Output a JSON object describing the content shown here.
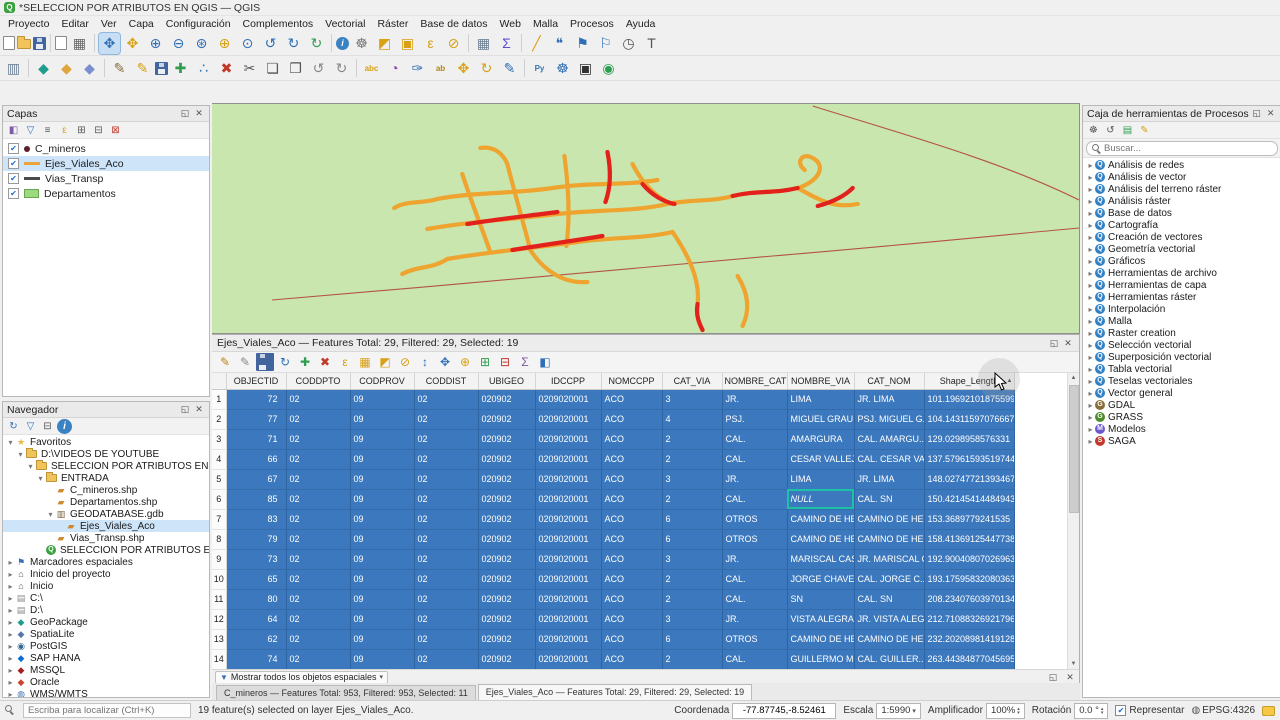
{
  "window": {
    "title": "*SELECCION POR ATRIBUTOS EN QGIS — QGIS"
  },
  "menubar": {
    "items": [
      "Proyecto",
      "Editar",
      "Ver",
      "Capa",
      "Configuración",
      "Complementos",
      "Vectorial",
      "Ráster",
      "Base de datos",
      "Web",
      "Malla",
      "Procesos",
      "Ayuda"
    ]
  },
  "toolbars": {
    "main": [
      {
        "n": "new-project",
        "t": "page"
      },
      {
        "n": "open-project",
        "t": "folder"
      },
      {
        "n": "save-project",
        "t": "disk"
      },
      {
        "sep": true
      },
      {
        "n": "new-print-layout",
        "t": "page"
      },
      {
        "n": "layout-manager",
        "g": "▦",
        "c": "#666666"
      },
      {
        "sep": true
      },
      {
        "n": "pan-map",
        "g": "✥",
        "c": "#2f6fb5",
        "active": true
      },
      {
        "n": "pan-to-selection",
        "g": "✥",
        "c": "#d8a013"
      },
      {
        "n": "zoom-in",
        "g": "⊕",
        "c": "#2f6fb5"
      },
      {
        "n": "zoom-out",
        "g": "⊖",
        "c": "#2f6fb5"
      },
      {
        "n": "zoom-full",
        "g": "⊛",
        "c": "#2f6fb5"
      },
      {
        "n": "zoom-to-selection",
        "g": "⊕",
        "c": "#d8a013"
      },
      {
        "n": "zoom-to-layer",
        "g": "⊙",
        "c": "#2f6fb5"
      },
      {
        "n": "zoom-last",
        "g": "↺",
        "c": "#2f6fb5"
      },
      {
        "n": "zoom-next",
        "g": "↻",
        "c": "#2f6fb5"
      },
      {
        "n": "refresh-map",
        "g": "↻",
        "c": "#2e9e4f"
      },
      {
        "sep": true
      },
      {
        "n": "identify-features",
        "t": "ci"
      },
      {
        "n": "run-feature-action",
        "g": "☸",
        "c": "#777777"
      },
      {
        "n": "select-features",
        "g": "◩",
        "c": "#d8a013"
      },
      {
        "n": "select-by-value",
        "g": "▣",
        "c": "#d8a013"
      },
      {
        "n": "select-by-expression",
        "g": "ε",
        "c": "#d8a013"
      },
      {
        "n": "deselect-all",
        "g": "⊘",
        "c": "#d8a013"
      },
      {
        "sep": true
      },
      {
        "n": "open-attribute-table",
        "g": "▦",
        "c": "#6b7f94"
      },
      {
        "n": "statistical-summary",
        "g": "Σ",
        "c": "#5a4fcf"
      },
      {
        "sep": true
      },
      {
        "n": "measure-line",
        "g": "╱",
        "c": "#d8a013"
      },
      {
        "n": "map-tips",
        "g": "❝",
        "c": "#2f6fb5"
      },
      {
        "n": "new-bookmark",
        "g": "⚑",
        "c": "#2f6fb5"
      },
      {
        "n": "show-bookmarks",
        "g": "⚐",
        "c": "#2f6fb5"
      },
      {
        "n": "temporal-controller",
        "g": "◷",
        "c": "#555555"
      },
      {
        "n": "text-annotation",
        "g": "T",
        "c": "#555555"
      }
    ],
    "digitizing": [
      {
        "n": "open-data-source-manager",
        "g": "▥",
        "c": "#6b7f94"
      },
      {
        "sep": true
      },
      {
        "n": "new-geopackage-layer",
        "g": "◆",
        "c": "#1f9d8b"
      },
      {
        "n": "new-shapefile-layer",
        "g": "◆",
        "c": "#e0a53c"
      },
      {
        "n": "new-virtual-layer",
        "g": "◆",
        "c": "#7b8fd0"
      },
      {
        "sep": true
      },
      {
        "n": "current-edits",
        "g": "✎",
        "c": "#8a6d3b"
      },
      {
        "n": "toggle-editing",
        "g": "✎",
        "c": "#d8a013"
      },
      {
        "n": "save-layer-edits",
        "t": "disk"
      },
      {
        "n": "add-line-feature",
        "g": "✚",
        "c": "#2e9e4f"
      },
      {
        "n": "vertex-tool",
        "g": "∴",
        "c": "#2f6fb5"
      },
      {
        "n": "delete-selected",
        "g": "✖",
        "c": "#c0392b"
      },
      {
        "n": "cut-features",
        "g": "✂",
        "c": "#555555"
      },
      {
        "n": "copy-features",
        "g": "❏",
        "c": "#555555"
      },
      {
        "n": "paste-features",
        "g": "❐",
        "c": "#555555"
      },
      {
        "n": "undo",
        "g": "↺",
        "c": "#888888"
      },
      {
        "n": "redo",
        "g": "↻",
        "c": "#888888"
      },
      {
        "sep": true
      },
      {
        "n": "layer-labeling",
        "g": "abc",
        "c": "#d8a013"
      },
      {
        "n": "layer-diagram",
        "g": "◔",
        "c": "#8e44ad"
      },
      {
        "n": "pin-labels",
        "g": "✑",
        "c": "#2f6fb5"
      },
      {
        "n": "highlight-labels",
        "g": "ab",
        "c": "#b8860b"
      },
      {
        "n": "move-label",
        "g": "✥",
        "c": "#d8a013"
      },
      {
        "n": "rotate-label",
        "g": "↻",
        "c": "#d8a013"
      },
      {
        "n": "change-label",
        "g": "✎",
        "c": "#2f6fb5"
      },
      {
        "sep": true
      },
      {
        "n": "python-console",
        "g": "Py",
        "c": "#3776ab"
      },
      {
        "n": "processing-toolbox",
        "g": "☸",
        "c": "#2f6fb5"
      },
      {
        "n": "vehicle-routing",
        "g": "▣",
        "c": "#333333"
      },
      {
        "n": "quickmap-services",
        "g": "◉",
        "c": "#2e9e4f"
      }
    ]
  },
  "layers_panel": {
    "title": "Capas",
    "toolbar": [
      {
        "n": "open-layer-styling",
        "g": "◧",
        "c": "#7d5ba6"
      },
      {
        "n": "filter-legend",
        "g": "▽",
        "c": "#2f6fb5"
      },
      {
        "n": "manage-map-themes",
        "g": "≡",
        "c": "#555555"
      },
      {
        "n": "filter-legend-expression",
        "g": "ε",
        "c": "#d8a013"
      },
      {
        "n": "expand-all",
        "g": "⊞",
        "c": "#555555"
      },
      {
        "n": "collapse-all",
        "g": "⊟",
        "c": "#555555"
      },
      {
        "n": "remove-layer",
        "g": "⊠",
        "c": "#c0392b"
      }
    ],
    "layers": [
      {
        "name": "C_mineros",
        "type": "point",
        "checked": true,
        "selected": false
      },
      {
        "name": "Ejes_Viales_Aco",
        "type": "line-orange",
        "checked": true,
        "selected": true
      },
      {
        "name": "Vias_Transp",
        "type": "line-dark",
        "checked": true,
        "selected": false
      },
      {
        "name": "Departamentos",
        "type": "polygon",
        "checked": true,
        "selected": false
      }
    ]
  },
  "browser_panel": {
    "title": "Navegador",
    "toolbar": [
      {
        "n": "refresh-browser",
        "g": "↻",
        "c": "#2f6fb5"
      },
      {
        "n": "filter-browser",
        "g": "▽",
        "c": "#2f6fb5"
      },
      {
        "n": "collapse-browser",
        "g": "⊟",
        "c": "#555555"
      },
      {
        "n": "browser-properties",
        "t": "ci"
      }
    ],
    "items": [
      {
        "label": "Favoritos",
        "depth": 0,
        "icon": "star",
        "expand": "v"
      },
      {
        "label": "D:\\VIDEOS DE YOUTUBE",
        "depth": 1,
        "icon": "folder",
        "expand": "v"
      },
      {
        "label": "SELECCION POR ATRIBUTOS EN QGIS",
        "depth": 2,
        "icon": "folder",
        "expand": "v"
      },
      {
        "label": "ENTRADA",
        "depth": 3,
        "icon": "folder",
        "expand": "v"
      },
      {
        "label": "C_mineros.shp",
        "depth": 4,
        "icon": "vector"
      },
      {
        "label": "Departamentos.shp",
        "depth": 4,
        "icon": "vector"
      },
      {
        "label": "GEODATABASE.gdb",
        "depth": 4,
        "icon": "database",
        "expand": "v"
      },
      {
        "label": "Ejes_Viales_Aco",
        "depth": 5,
        "icon": "vector",
        "selected": true
      },
      {
        "label": "Vias_Transp.shp",
        "depth": 4,
        "icon": "vector"
      },
      {
        "label": "SELECCION POR ATRIBUTOS EN QGIS",
        "depth": 3,
        "icon": "project"
      },
      {
        "label": "Marcadores espaciales",
        "depth": 0,
        "icon": "bookmark",
        "expand": ">"
      },
      {
        "label": "Inicio del proyecto",
        "depth": 0,
        "icon": "home",
        "expand": ">"
      },
      {
        "label": "Inicio",
        "depth": 0,
        "icon": "home",
        "expand": ">"
      },
      {
        "label": "C:\\",
        "depth": 0,
        "icon": "drive",
        "expand": ">"
      },
      {
        "label": "D:\\",
        "depth": 0,
        "icon": "drive",
        "expand": ">"
      },
      {
        "label": "GeoPackage",
        "depth": 0,
        "icon": "gpkg",
        "expand": ">"
      },
      {
        "label": "SpatiaLite",
        "depth": 0,
        "icon": "sqlite",
        "expand": ">"
      },
      {
        "label": "PostGIS",
        "depth": 0,
        "icon": "postgis",
        "expand": ">"
      },
      {
        "label": "SAP HANA",
        "depth": 0,
        "icon": "hana",
        "expand": ">"
      },
      {
        "label": "MSSQL",
        "depth": 0,
        "icon": "mssql",
        "expand": ">"
      },
      {
        "label": "Oracle",
        "depth": 0,
        "icon": "oracle",
        "expand": ">"
      },
      {
        "label": "WMS/WMTS",
        "depth": 0,
        "icon": "wms",
        "expand": ">"
      }
    ]
  },
  "browser_icon_glyphs": {
    "star": {
      "g": "★",
      "c": "#e8b93c"
    },
    "vector": {
      "g": "▰",
      "c": "#cd8a2e"
    },
    "database": {
      "g": "▥",
      "c": "#7a5c3a"
    },
    "bookmark": {
      "g": "⚑",
      "c": "#3b6fb5"
    },
    "home": {
      "g": "⌂",
      "c": "#555555"
    },
    "drive": {
      "g": "▤",
      "c": "#8a8a8a"
    },
    "gpkg": {
      "g": "◆",
      "c": "#1f9d8b"
    },
    "sqlite": {
      "g": "◆",
      "c": "#5577aa"
    },
    "postgis": {
      "g": "◉",
      "c": "#336791"
    },
    "hana": {
      "g": "◆",
      "c": "#0a6ed1"
    },
    "mssql": {
      "g": "◆",
      "c": "#a91d22"
    },
    "oracle": {
      "g": "◆",
      "c": "#c74634"
    },
    "wms": {
      "g": "◍",
      "c": "#3b6fb5"
    }
  },
  "toolbox_panel": {
    "title": "Caja de herramientas de Procesos",
    "search_placeholder": "Buscar...",
    "toolbar": [
      {
        "n": "processing-options",
        "g": "☸",
        "c": "#555555"
      },
      {
        "n": "processing-history",
        "g": "↺",
        "c": "#555555"
      },
      {
        "n": "results-viewer",
        "g": "▤",
        "c": "#2e9e4f"
      },
      {
        "n": "edit-features-in-place",
        "g": "✎",
        "c": "#d8a013"
      }
    ],
    "badges": {
      "q": {
        "letter": "Q",
        "color": "#2f81c7"
      },
      "gdal": {
        "letter": "G",
        "color": "#8a6d3b"
      },
      "grass": {
        "letter": "G",
        "color": "#4c8c2b"
      },
      "model": {
        "letter": "M",
        "color": "#6a5acd"
      },
      "saga": {
        "letter": "S",
        "color": "#c0392b"
      }
    },
    "groups": [
      {
        "label": "Análisis de redes",
        "icon": "q"
      },
      {
        "label": "Análisis de vector",
        "icon": "q"
      },
      {
        "label": "Análisis del terreno ráster",
        "icon": "q"
      },
      {
        "label": "Análisis ráster",
        "icon": "q"
      },
      {
        "label": "Base de datos",
        "icon": "q"
      },
      {
        "label": "Cartografía",
        "icon": "q"
      },
      {
        "label": "Creación de vectores",
        "icon": "q"
      },
      {
        "label": "Geometría vectorial",
        "icon": "q"
      },
      {
        "label": "Gráficos",
        "icon": "q"
      },
      {
        "label": "Herramientas de archivo",
        "icon": "q"
      },
      {
        "label": "Herramientas de capa",
        "icon": "q"
      },
      {
        "label": "Herramientas ráster",
        "icon": "q"
      },
      {
        "label": "Interpolación",
        "icon": "q"
      },
      {
        "label": "Malla",
        "icon": "q"
      },
      {
        "label": "Raster creation",
        "icon": "q"
      },
      {
        "label": "Selección vectorial",
        "icon": "q"
      },
      {
        "label": "Superposición vectorial",
        "icon": "q"
      },
      {
        "label": "Tabla vectorial",
        "icon": "q"
      },
      {
        "label": "Teselas vectoriales",
        "icon": "q"
      },
      {
        "label": "Vector general",
        "icon": "q"
      },
      {
        "label": "GDAL",
        "icon": "gdal"
      },
      {
        "label": "GRASS",
        "icon": "grass"
      },
      {
        "label": "Modelos",
        "icon": "model"
      },
      {
        "label": "SAGA",
        "icon": "saga"
      }
    ]
  },
  "attribute_table": {
    "title": "Ejes_Viales_Aco — Features Total: 29, Filtered: 29, Selected: 19",
    "toolbar": [
      {
        "n": "table-toggle-editing",
        "g": "✎",
        "c": "#b8860b"
      },
      {
        "n": "table-multiedit",
        "g": "✎",
        "c": "#888888"
      },
      {
        "n": "table-save-edits",
        "t": "disk"
      },
      {
        "n": "table-reload",
        "g": "↻",
        "c": "#2f6fb5"
      },
      {
        "n": "table-add-feature",
        "g": "✚",
        "c": "#2e9e4f"
      },
      {
        "n": "table-delete-selected",
        "g": "✖",
        "c": "#c0392b"
      },
      {
        "n": "table-select-by-expression",
        "g": "ε",
        "c": "#d8a013"
      },
      {
        "n": "table-select-all",
        "g": "▦",
        "c": "#d8a013"
      },
      {
        "n": "table-invert-selection",
        "g": "◩",
        "c": "#d8a013"
      },
      {
        "n": "table-deselect-all",
        "g": "⊘",
        "c": "#d8a013"
      },
      {
        "n": "table-move-selection-top",
        "g": "↕",
        "c": "#2f6fb5"
      },
      {
        "n": "table-pan-to-selection",
        "g": "✥",
        "c": "#2f6fb5"
      },
      {
        "n": "table-zoom-to-selection",
        "g": "⊕",
        "c": "#d8a013"
      },
      {
        "n": "table-new-field",
        "g": "⊞",
        "c": "#2e9e4f"
      },
      {
        "n": "table-delete-field",
        "g": "⊟",
        "c": "#c0392b"
      },
      {
        "n": "table-field-calculator",
        "g": "Σ",
        "c": "#7a5c9e"
      },
      {
        "n": "table-conditional-formatting",
        "g": "◧",
        "c": "#2f6fb5"
      }
    ],
    "columns": [
      "OBJECTID",
      "CODDPTO",
      "CODPROV",
      "CODDIST",
      "UBIGEO",
      "IDCCPP",
      "NOMCCPP",
      "CAT_VIA",
      "NOMBRE_CAT",
      "NOMBRE_VIA",
      "CAT_NOM",
      "Shape_Length"
    ],
    "sorted_column": "Shape_Length",
    "sort_direction": "asc",
    "filter_button": "Mostrar todos los objetos espaciales",
    "null_cell": {
      "row": 5,
      "col": 9
    },
    "rows": [
      [
        "72",
        "02",
        "09",
        "02",
        "020902",
        "0209020001",
        "ACO",
        "3",
        "JR.",
        "LIMA",
        "JR. LIMA",
        "101.19692101875599"
      ],
      [
        "77",
        "02",
        "09",
        "02",
        "020902",
        "0209020001",
        "ACO",
        "4",
        "PSJ.",
        "MIGUEL GRAU",
        "PSJ. MIGUEL G...",
        "104.14311597076667"
      ],
      [
        "71",
        "02",
        "09",
        "02",
        "020902",
        "0209020001",
        "ACO",
        "2",
        "CAL.",
        "AMARGURA",
        "CAL. AMARGU...",
        "129.0298958576331"
      ],
      [
        "66",
        "02",
        "09",
        "02",
        "020902",
        "0209020001",
        "ACO",
        "2",
        "CAL.",
        "CESAR VALLEJO",
        "CAL. CESAR VA...",
        "137.57961593519744"
      ],
      [
        "67",
        "02",
        "09",
        "02",
        "020902",
        "0209020001",
        "ACO",
        "3",
        "JR.",
        "LIMA",
        "JR. LIMA",
        "148.02747721393467"
      ],
      [
        "85",
        "02",
        "09",
        "02",
        "020902",
        "0209020001",
        "ACO",
        "2",
        "CAL.",
        "NULL",
        "CAL. SN",
        "150.42145414484943"
      ],
      [
        "83",
        "02",
        "09",
        "02",
        "020902",
        "0209020001",
        "ACO",
        "6",
        "OTROS",
        "CAMINO DE HE...",
        "CAMINO DE HE...",
        "153.3689779241535"
      ],
      [
        "79",
        "02",
        "09",
        "02",
        "020902",
        "0209020001",
        "ACO",
        "6",
        "OTROS",
        "CAMINO DE HE...",
        "CAMINO DE HE...",
        "158.41369125447738"
      ],
      [
        "73",
        "02",
        "09",
        "02",
        "020902",
        "0209020001",
        "ACO",
        "3",
        "JR.",
        "MARISCAL CAS...",
        "JR. MARISCAL C...",
        "192.90040807026963"
      ],
      [
        "65",
        "02",
        "09",
        "02",
        "020902",
        "0209020001",
        "ACO",
        "2",
        "CAL.",
        "JORGE CHAVEZ",
        "CAL. JORGE C...",
        "193.17595832080363"
      ],
      [
        "80",
        "02",
        "09",
        "02",
        "020902",
        "0209020001",
        "ACO",
        "2",
        "CAL.",
        "SN",
        "CAL. SN",
        "208.23407603970134"
      ],
      [
        "64",
        "02",
        "09",
        "02",
        "020902",
        "0209020001",
        "ACO",
        "3",
        "JR.",
        "VISTA ALEGRA",
        "JR. VISTA ALEG...",
        "212.71088326921796"
      ],
      [
        "62",
        "02",
        "09",
        "02",
        "020902",
        "0209020001",
        "ACO",
        "6",
        "OTROS",
        "CAMINO DE HE...",
        "CAMINO DE HE...",
        "232.20208981419128"
      ],
      [
        "74",
        "02",
        "09",
        "02",
        "020902",
        "0209020001",
        "ACO",
        "2",
        "CAL.",
        "GUILLERMO M...",
        "CAL. GUILLER...",
        "263.44384877045695"
      ]
    ]
  },
  "dock_tabs": [
    {
      "label": "C_mineros — Features Total: 953, Filtered: 953, Selected: 11",
      "active": false
    },
    {
      "label": "Ejes_Viales_Aco — Features Total: 29, Filtered: 29, Selected: 19",
      "active": true
    }
  ],
  "statusbar": {
    "locator_placeholder": "Escriba para localizar (Ctrl+K)",
    "message": "19 feature(s) selected on layer Ejes_Viales_Aco.",
    "coordinate_label": "Coordenada",
    "coordinate": "-77.87745,-8.52461",
    "scale_label": "Escala",
    "scale": "1:5990",
    "magnifier_label": "Amplificador",
    "magnifier": "100%",
    "rotation_label": "Rotación",
    "rotation": "0.0 °",
    "render_label": "Representar",
    "crs": "EPSG:4326"
  }
}
